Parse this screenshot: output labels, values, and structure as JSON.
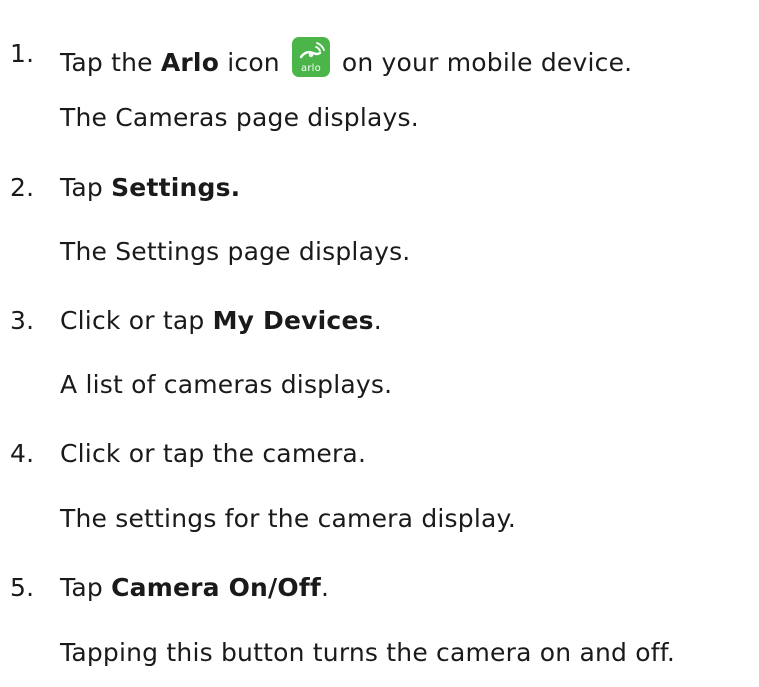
{
  "steps": [
    {
      "number": "1.",
      "pre": "Tap the ",
      "bold": "Arlo",
      "mid": " icon",
      "post": "on your mobile device.",
      "result": "The Cameras page displays.",
      "icon": "arlo-app-icon",
      "icon_label": "arlo"
    },
    {
      "number": "2.",
      "pre": "Tap ",
      "bold": "Settings.",
      "post": "",
      "result": "The Settings page displays."
    },
    {
      "number": "3.",
      "pre": "Click or tap ",
      "bold": "My Devices",
      "post": ".",
      "result": "A list of cameras displays."
    },
    {
      "number": "4.",
      "pre": "Click or tap the camera.",
      "bold": "",
      "post": "",
      "result": "The settings for the camera display."
    },
    {
      "number": "5.",
      "pre": "Tap ",
      "bold": "Camera On/Off",
      "post": ".",
      "result": "Tapping this button turns the camera on and off."
    }
  ],
  "colors": {
    "text": "#1a1a1a",
    "arlo_green": "#4bb54a"
  }
}
